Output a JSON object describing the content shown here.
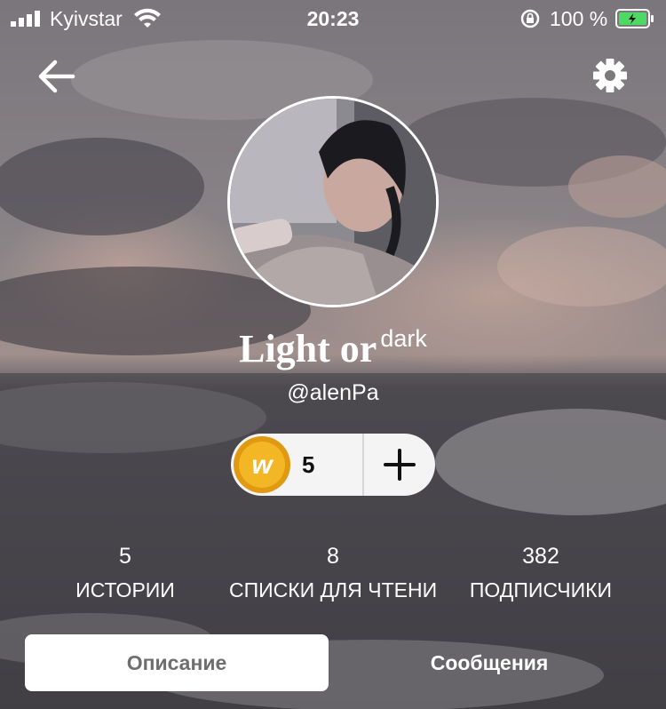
{
  "status": {
    "carrier": "Kyivstar",
    "time": "20:23",
    "battery_pct": "100 %"
  },
  "profile": {
    "display_name": "Light or",
    "display_name_suffix": "dark",
    "username": "@alenPa"
  },
  "coins": {
    "count": "5",
    "icon_letter": "w"
  },
  "stats": [
    {
      "value": "5",
      "label": "ИСТОРИИ"
    },
    {
      "value": "8",
      "label": "СПИСКИ ДЛЯ ЧТЕНИЯ"
    },
    {
      "value": "382",
      "label": "ПОДПИСЧИКИ"
    }
  ],
  "tabs": {
    "description": "Описание",
    "messages": "Сообщения"
  },
  "icons": [
    "signal-icon",
    "wifi-icon",
    "rotation-lock-icon",
    "battery-icon",
    "back-arrow-icon",
    "gear-icon",
    "coin-icon",
    "plus-icon"
  ],
  "colors": {
    "battery_green": "#4cd964",
    "coin_gold": "#f3b624"
  }
}
